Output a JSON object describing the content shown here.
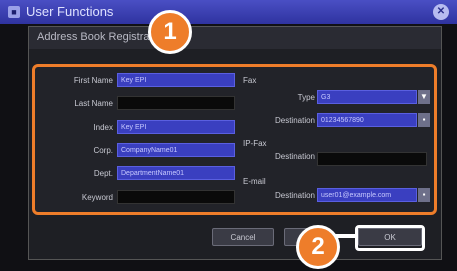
{
  "window": {
    "title": "User Functions"
  },
  "dialog": {
    "title": "Address Book Registration"
  },
  "form": {
    "first_name": {
      "label": "First Name",
      "value": "Key EPI"
    },
    "last_name": {
      "label": "Last Name",
      "value": ""
    },
    "index": {
      "label": "Index",
      "value": "Key EPI"
    },
    "corp": {
      "label": "Corp.",
      "value": "CompanyName01"
    },
    "dept": {
      "label": "Dept.",
      "value": "DepartmentName01"
    },
    "keyword": {
      "label": "Keyword",
      "value": ""
    },
    "fax": {
      "label": "Fax",
      "type_label": "Type",
      "type_value": "G3",
      "dest_label": "Destination",
      "dest_value": "01234567890"
    },
    "ipfax": {
      "label": "IP-Fax",
      "dest_label": "Destination",
      "dest_value": ""
    },
    "email": {
      "label": "E-mail",
      "dest_label": "Destination",
      "dest_value": "user01@example.com"
    }
  },
  "buttons": {
    "cancel": "Cancel",
    "ok": "OK"
  },
  "callouts": {
    "one": "1",
    "two": "2"
  }
}
